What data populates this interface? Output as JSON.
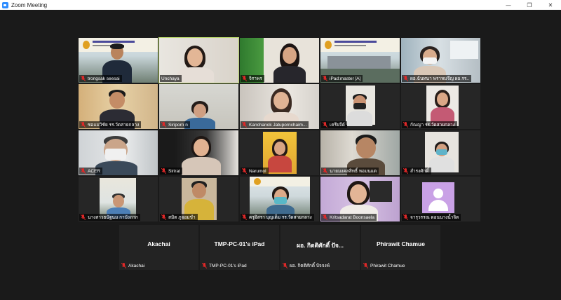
{
  "window": {
    "title": "Zoom Meeting",
    "minimize_glyph": "—",
    "maximize_glyph": "❐",
    "close_glyph": "✕"
  },
  "participants": [
    {
      "name": "trongsak seesai"
    },
    {
      "name": "Unchaya"
    },
    {
      "name": "จิราพร"
    },
    {
      "name": "iPad:master [A]"
    },
    {
      "name": "ผอ.ฉันทนา  พราหมจีญ  ผอ.รร.."
    },
    {
      "name": "ซอแมวิชัย  รร.วัดสายกลาง"
    },
    {
      "name": "Siriporn n"
    },
    {
      "name": "Kanchanok Jatupornchaim..."
    },
    {
      "name": "เครียจีด์"
    },
    {
      "name": "กัณญา  รร.วัดสายกลาง"
    },
    {
      "name": "ACER"
    },
    {
      "name": "Sirirat"
    },
    {
      "name": "Narumol"
    },
    {
      "name": "นายมงคลสิทธิ์  หอมนแต"
    },
    {
      "name": "สำรงศักดิ์"
    },
    {
      "name": "นางสาวธนัฐนม  กาบังภาก"
    },
    {
      "name": "สมิต  ภูจอมขำ"
    },
    {
      "name": "ครูอิสรา  บุญเต็ม  รร.วัดสายกลาง"
    },
    {
      "name": "Kritsadarat Boonsaela"
    },
    {
      "name": "จารุวรรณ  ดอนนางน้ำจิต"
    }
  ],
  "no_video": [
    {
      "display": "Akachai",
      "name": "Akachai"
    },
    {
      "display": "TMP-PC-01's iPad",
      "name": "TMP-PC-01's iPad"
    },
    {
      "display": "ผอ. กิตติศักดิ์  ปัจ...",
      "name": "ผอ. กิตติศักดิ์  ปัจจงพ์"
    },
    {
      "display": "Phirawit Chamue",
      "name": "Phirawit Chamue"
    }
  ],
  "colors": {
    "active_speaker_border": "#b5d26a",
    "mic_muted": "#e02828",
    "avatar_bg": "#c9a1e6"
  }
}
